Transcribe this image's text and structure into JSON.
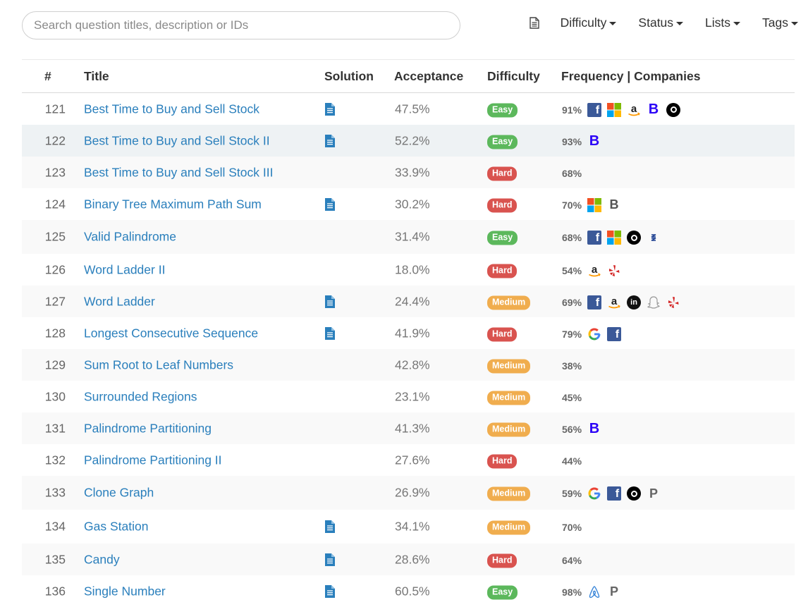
{
  "search": {
    "placeholder": "Search question titles, description or IDs",
    "value": ""
  },
  "filters": {
    "difficulty": "Difficulty",
    "status": "Status",
    "lists": "Lists",
    "tags": "Tags"
  },
  "table": {
    "headers": {
      "num": "#",
      "title": "Title",
      "solution": "Solution",
      "acceptance": "Acceptance",
      "difficulty": "Difficulty",
      "frequency": "Frequency | Companies"
    },
    "rows": [
      {
        "num": "121",
        "title": "Best Time to Buy and Sell Stock",
        "solution": true,
        "acceptance": "47.5%",
        "difficulty": "Easy",
        "frequency": "91%",
        "companies": [
          "facebook",
          "microsoft",
          "amazon",
          "bloomberg",
          "uber"
        ]
      },
      {
        "num": "122",
        "title": "Best Time to Buy and Sell Stock II",
        "solution": true,
        "acceptance": "52.2%",
        "difficulty": "Easy",
        "frequency": "93%",
        "companies": [
          "bloomberg"
        ]
      },
      {
        "num": "123",
        "title": "Best Time to Buy and Sell Stock III",
        "solution": false,
        "acceptance": "33.9%",
        "difficulty": "Hard",
        "frequency": "68%",
        "companies": []
      },
      {
        "num": "124",
        "title": "Binary Tree Maximum Path Sum",
        "solution": true,
        "acceptance": "30.2%",
        "difficulty": "Hard",
        "frequency": "70%",
        "companies": [
          "microsoft",
          "baidu"
        ]
      },
      {
        "num": "125",
        "title": "Valid Palindrome",
        "solution": false,
        "acceptance": "31.4%",
        "difficulty": "Easy",
        "frequency": "68%",
        "companies": [
          "facebook",
          "microsoft",
          "uber",
          "zenefits"
        ]
      },
      {
        "num": "126",
        "title": "Word Ladder II",
        "solution": false,
        "acceptance": "18.0%",
        "difficulty": "Hard",
        "frequency": "54%",
        "companies": [
          "amazon",
          "yelp"
        ]
      },
      {
        "num": "127",
        "title": "Word Ladder",
        "solution": true,
        "acceptance": "24.4%",
        "difficulty": "Medium",
        "frequency": "69%",
        "companies": [
          "facebook",
          "amazon",
          "linkedin",
          "snapchat",
          "yelp"
        ]
      },
      {
        "num": "128",
        "title": "Longest Consecutive Sequence",
        "solution": true,
        "acceptance": "41.9%",
        "difficulty": "Hard",
        "frequency": "79%",
        "companies": [
          "google",
          "facebook"
        ]
      },
      {
        "num": "129",
        "title": "Sum Root to Leaf Numbers",
        "solution": false,
        "acceptance": "42.8%",
        "difficulty": "Medium",
        "frequency": "38%",
        "companies": []
      },
      {
        "num": "130",
        "title": "Surrounded Regions",
        "solution": false,
        "acceptance": "23.1%",
        "difficulty": "Medium",
        "frequency": "45%",
        "companies": []
      },
      {
        "num": "131",
        "title": "Palindrome Partitioning",
        "solution": false,
        "acceptance": "41.3%",
        "difficulty": "Medium",
        "frequency": "56%",
        "companies": [
          "bloomberg"
        ]
      },
      {
        "num": "132",
        "title": "Palindrome Partitioning II",
        "solution": false,
        "acceptance": "27.6%",
        "difficulty": "Hard",
        "frequency": "44%",
        "companies": []
      },
      {
        "num": "133",
        "title": "Clone Graph",
        "solution": false,
        "acceptance": "26.9%",
        "difficulty": "Medium",
        "frequency": "59%",
        "companies": [
          "google",
          "facebook",
          "uber",
          "pocketgems"
        ]
      },
      {
        "num": "134",
        "title": "Gas Station",
        "solution": true,
        "acceptance": "34.1%",
        "difficulty": "Medium",
        "frequency": "70%",
        "companies": []
      },
      {
        "num": "135",
        "title": "Candy",
        "solution": true,
        "acceptance": "28.6%",
        "difficulty": "Hard",
        "frequency": "64%",
        "companies": []
      },
      {
        "num": "136",
        "title": "Single Number",
        "solution": true,
        "acceptance": "60.5%",
        "difficulty": "Easy",
        "frequency": "98%",
        "companies": [
          "airbnb",
          "pocketgems"
        ]
      }
    ]
  },
  "colors": {
    "link": "#2a7fbc",
    "easy": "#5cb85c",
    "medium": "#f0ad4e",
    "hard": "#d9534f",
    "solution_icon": "#2a7fbc"
  }
}
